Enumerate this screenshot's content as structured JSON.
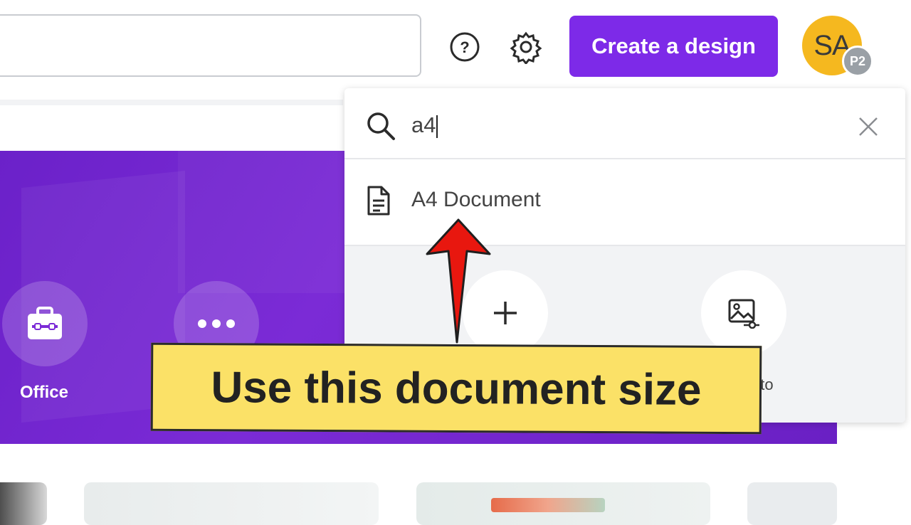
{
  "header": {
    "search_value": "",
    "create_button_label": "Create a design",
    "avatar_initials": "SA",
    "avatar_badge": "P2"
  },
  "banner": {
    "categories": [
      {
        "label": "Office",
        "icon": "briefcase-icon"
      },
      {
        "label": "",
        "icon": "more-dots-icon"
      }
    ]
  },
  "dropdown": {
    "query": "a4",
    "results": [
      {
        "label": "A4 Document",
        "icon": "document-icon"
      }
    ],
    "actions": [
      {
        "label": "",
        "icon": "plus-icon"
      },
      {
        "label": "oto",
        "icon": "photo-edit-icon"
      }
    ]
  },
  "annotation": {
    "callout_text": "Use this document size",
    "arrow_color": "#e8170f",
    "callout_color": "#fbe167"
  },
  "colors": {
    "brand_purple": "#7d2ae8",
    "avatar": "#f5b81f"
  }
}
